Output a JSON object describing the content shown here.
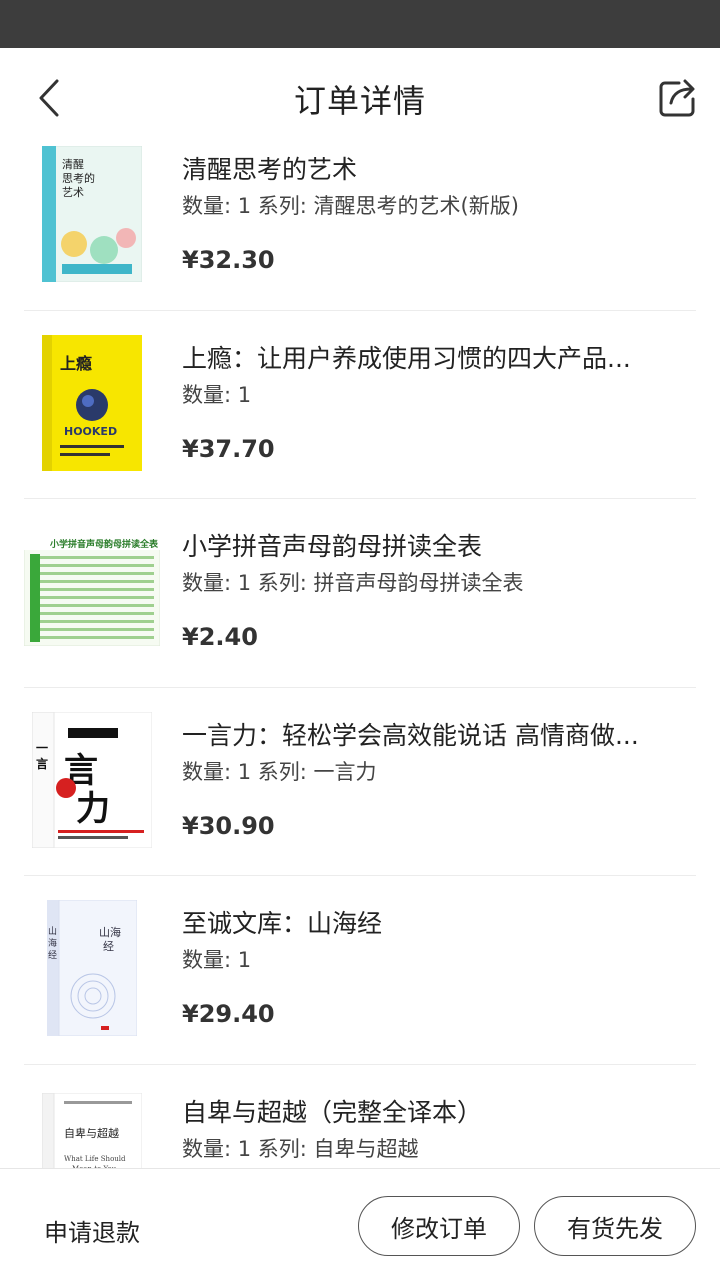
{
  "header": {
    "title": "订单详情",
    "back_icon": "chevron-left-icon",
    "share_icon": "share-icon"
  },
  "items": [
    {
      "title": "清醒思考的艺术",
      "meta": "数量: 1 系列: 清醒思考的艺术(新版)",
      "price": "¥32.30",
      "cover": {
        "bg": "#e8f4f0",
        "band": "#3fb6c9",
        "text": "清醒\n思考的\n艺术",
        "text_color": "#222"
      }
    },
    {
      "title": "上瘾：让用户养成使用习惯的四大产品...",
      "meta": "数量: 1",
      "price": "¥37.70",
      "cover": {
        "bg": "#f5e400",
        "band": "#1a2a5a",
        "text": "上瘾",
        "sub": "HOOKED",
        "text_color": "#222"
      }
    },
    {
      "title": "小学拼音声母韵母拼读全表",
      "meta": "数量: 1 系列: 拼音声母韵母拼读全表",
      "price": "¥2.40",
      "cover": {
        "bg": "#f4faf0",
        "band": "#3aa83a",
        "text": "小学拼音声母韵母拼读全表",
        "text_color": "#2b7d2b"
      }
    },
    {
      "title": "一言力：轻松学会高效能说话 高情商做...",
      "meta": "数量: 1 系列: 一言力",
      "price": "¥30.90",
      "cover": {
        "bg": "#ffffff",
        "band": "#d62020",
        "text": "一言力",
        "text_color": "#111"
      }
    },
    {
      "title": "至诚文库：山海经",
      "meta": "数量: 1",
      "price": "¥29.40",
      "cover": {
        "bg": "#eef1fa",
        "band": "#9fb0d8",
        "text": "山海经",
        "text_color": "#334"
      }
    },
    {
      "title": "自卑与超越（完整全译本）",
      "meta": "数量: 1 系列: 自卑与超越",
      "price": "",
      "cover": {
        "bg": "#ffffff",
        "band": "#c7c7c7",
        "text": "自卑与超越",
        "sub": "What Life Should Mean to You",
        "text_color": "#222"
      }
    }
  ],
  "bottom": {
    "refund_label": "申请退款",
    "modify_label": "修改订单",
    "instock_label": "有货先发"
  }
}
